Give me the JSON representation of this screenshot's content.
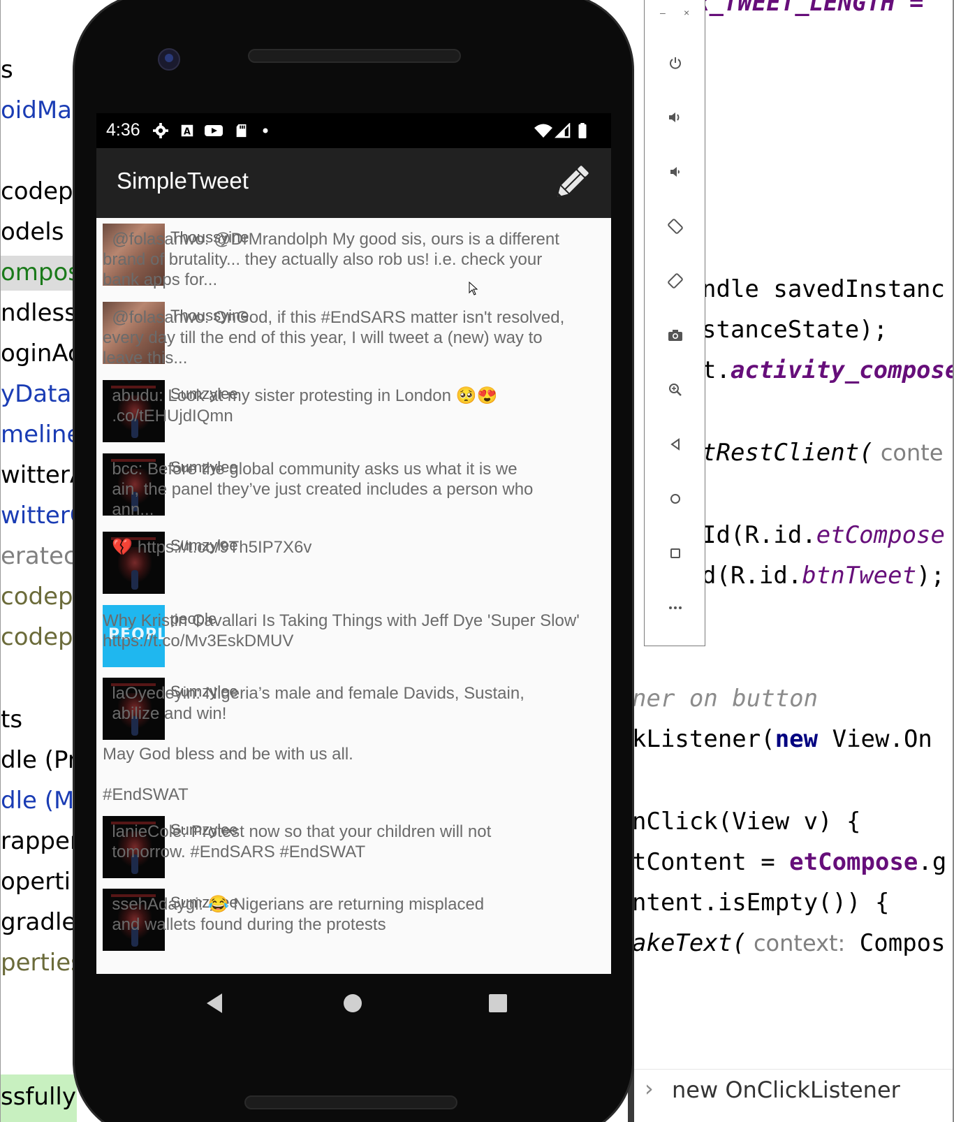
{
  "ide_left": {
    "items": [
      {
        "text": "s",
        "color": "#000000"
      },
      {
        "text": "oidMar",
        "color": "#1a3cb4"
      },
      {
        "text": "codepa",
        "color": "#000000"
      },
      {
        "text": "odels",
        "color": "#000000"
      },
      {
        "text": "ompos",
        "color": "#1a7a1a"
      },
      {
        "text": "ndlessF",
        "color": "#000000"
      },
      {
        "text": "oginAc",
        "color": "#000000"
      },
      {
        "text": "yDatab",
        "color": "#1a3cb4"
      },
      {
        "text": "meline",
        "color": "#1a3cb4"
      },
      {
        "text": "witterA",
        "color": "#000000"
      },
      {
        "text": "witterC",
        "color": "#1a3cb4"
      },
      {
        "text": "eratec",
        "color": "#808080"
      },
      {
        "text": "codepa",
        "color": "#6b6b3a"
      },
      {
        "text": "codepa",
        "color": "#6b6b3a"
      },
      {
        "text": "ts",
        "color": "#000000"
      },
      {
        "text": "dle (Pr",
        "color": "#000000"
      },
      {
        "text": "dle (M",
        "color": "#1a3cb4"
      },
      {
        "text": "rapper",
        "color": "#000000"
      },
      {
        "text": "operti",
        "color": "#000000"
      },
      {
        "text": "gradle",
        "color": "#000000"
      },
      {
        "text": "perties",
        "color": "#6b6b3a"
      }
    ],
    "status_text": "ssfully"
  },
  "ide_right": {
    "line_top": "k_TWEET_LENGTH =",
    "line_1": "ndle savedInstanc",
    "line_2": "stanceState);",
    "line_3a": "t.",
    "line_3b": "activity_compose",
    "line_4a": "tRestClient(",
    "line_4b": " conte",
    "line_5a": "Id(R.id.",
    "line_5b": "etCompose",
    "line_6a": "d(R.id.",
    "line_6b": "btnTweet",
    "line_6c": ");",
    "line_7": "ner on button",
    "line_8a": "kListener(",
    "line_8b": "new",
    "line_8c": " View.On",
    "line_9": "nClick(View v) {",
    "line_10a": "tContent = ",
    "line_10b": "etCompose",
    "line_10c": ".g",
    "line_11": "ntent.isEmpty()) {",
    "line_12a": "akeText(",
    "line_12b": " context:",
    "line_12c": " Compos",
    "breadcrumb": "new OnClickListener"
  },
  "emulator_toolbar": {
    "minimize": "–",
    "close": "×",
    "buttons": [
      "power-icon",
      "volume-up-icon",
      "volume-down-icon",
      "rotate-left-icon",
      "rotate-right-icon",
      "camera-icon",
      "zoom-icon",
      "back-icon",
      "home-icon",
      "overview-icon",
      "more-icon"
    ]
  },
  "status_bar": {
    "time": "4:36"
  },
  "app_bar": {
    "title": "SimpleTweet"
  },
  "tweets": [
    {
      "username": "Thoussyine",
      "body": "  @folasanwo: @DrMrandolph My good sis, ours is a different\nbrand of brutality... they actually also rob us! i.e. check your\nbank apps for...",
      "avatar": "hand"
    },
    {
      "username": "Thoussyine",
      "body": "  @folasanwo: OnGod, if this #EndSARS matter isn't resolved,\nevery day till the end of this year, I will tweet a (new) way to\nleave this...",
      "avatar": "hand"
    },
    {
      "username": "Sumzylee",
      "body": "  abudu: Look at my sister protesting in London 🥺😍\n  .co/tEHUjdIQmn",
      "avatar": "dark"
    },
    {
      "username": "Sumzylee",
      "body": "  bcc: Before the global community asks us what it is we\n  ain, the panel they’ve just created includes a person who\n  ann...",
      "avatar": "dark"
    },
    {
      "username": "Sumzylee",
      "body": "  💔 https://t.co/9Th5IP7X6v",
      "avatar": "dark"
    },
    {
      "username": "people",
      "body": "Why Kristin Cavallari Is Taking Things with Jeff Dye 'Super Slow'\nhttps://t.co/Mv3EskDMUV",
      "avatar": "cyan",
      "avatar_text": "PEOPLE"
    },
    {
      "username": "Sumzylee",
      "body": "  laOyedeyin: Nigeria’s male and female Davids, Sustain,\n  abilize and win!\n\nMay God bless and be with us all.\n\n#EndSWAT",
      "avatar": "dark"
    },
    {
      "username": "Sumzylee",
      "body": "  lanieCole: Protest now so that your children will not\n  tomorrow. #EndSARS #EndSWAT",
      "avatar": "dark"
    },
    {
      "username": "Sumzylee",
      "body": "  ssehAdaygi: 😂 Nigerians are returning misplaced\n  and wallets found during the protests",
      "avatar": "dark"
    }
  ]
}
